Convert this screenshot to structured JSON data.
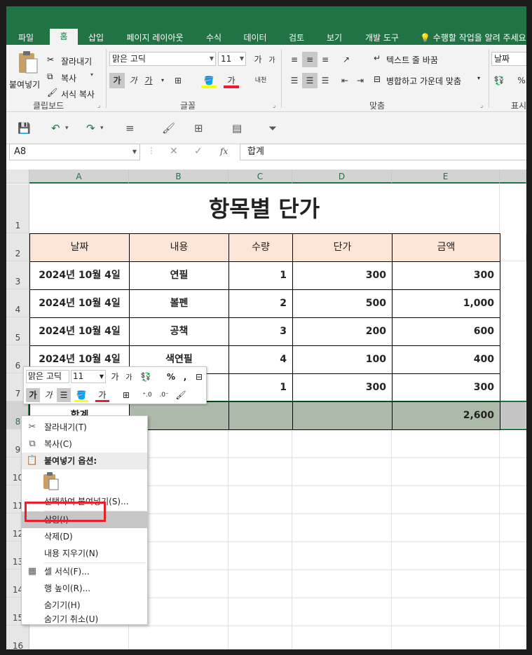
{
  "ribbon": {
    "tabs": [
      "파일",
      "홈",
      "삽입",
      "페이지 레이아웃",
      "수식",
      "데이터",
      "검토",
      "보기",
      "개발 도구"
    ],
    "active_tab": "홈",
    "tell_me": "수행할 작업을 알려 주세요",
    "clipboard": {
      "paste_label": "붙여넣기",
      "cut_label": "잘라내기",
      "copy_label": "복사",
      "format_painter_label": "서식 복사",
      "group_label": "클립보드"
    },
    "font": {
      "font_name": "맑은 고딕",
      "font_size": "11",
      "bold": "가",
      "italic": "가",
      "underline": "가",
      "font_color": "가",
      "phonetic": "내천",
      "group_label": "글꼴"
    },
    "alignment": {
      "wrap_text_label": "텍스트 줄 바꿈",
      "merge_center_label": "병합하고 가운데 맞춤",
      "group_label": "맞춤"
    },
    "number": {
      "format": "날짜",
      "percent": "%",
      "group_label": "표시"
    }
  },
  "formula_bar": {
    "name_box": "A8",
    "formula": "합계",
    "fx": "fx"
  },
  "sheet": {
    "columns": [
      "A",
      "B",
      "C",
      "D",
      "E"
    ],
    "row_numbers": [
      "1",
      "2",
      "3",
      "4",
      "5",
      "6",
      "7",
      "8",
      "9",
      "10",
      "11",
      "12",
      "13",
      "14",
      "15",
      "16"
    ],
    "title": "항목별 단가",
    "headers": [
      "날짜",
      "내용",
      "수량",
      "단가",
      "금액"
    ],
    "rows": [
      [
        "2024년 10월 4일",
        "연필",
        "1",
        "300",
        "300"
      ],
      [
        "2024년 10월 4일",
        "볼펜",
        "2",
        "500",
        "1,000"
      ],
      [
        "2024년 10월 4일",
        "공책",
        "3",
        "200",
        "600"
      ],
      [
        "2024년 10월 4일",
        "색연필",
        "4",
        "100",
        "400"
      ],
      [
        "",
        "",
        "1",
        "300",
        "300"
      ]
    ],
    "total_label": "합계",
    "total_value": "2,600"
  },
  "mini_toolbar": {
    "font_name": "맑은 고딕",
    "font_size": "11",
    "percent": "%",
    "comma": ","
  },
  "context_menu": {
    "cut": "잘라내기(T)",
    "copy": "복사(C)",
    "paste_options": "붙여넣기 옵션:",
    "paste_special": "선택하여 붙여넣기(S)...",
    "insert": "삽입(I)",
    "delete": "삭제(D)",
    "clear_contents": "내용 지우기(N)",
    "format_cells": "셀 서식(F)...",
    "row_height": "행 높이(R)...",
    "hide": "숨기기(H)",
    "unhide": "숨기기 취소(U)"
  },
  "colors": {
    "excel_green": "#217346",
    "header_fill": "#fce4d6",
    "selected_row_fill": "#aebaa9",
    "highlight_red": "#e8202a"
  }
}
